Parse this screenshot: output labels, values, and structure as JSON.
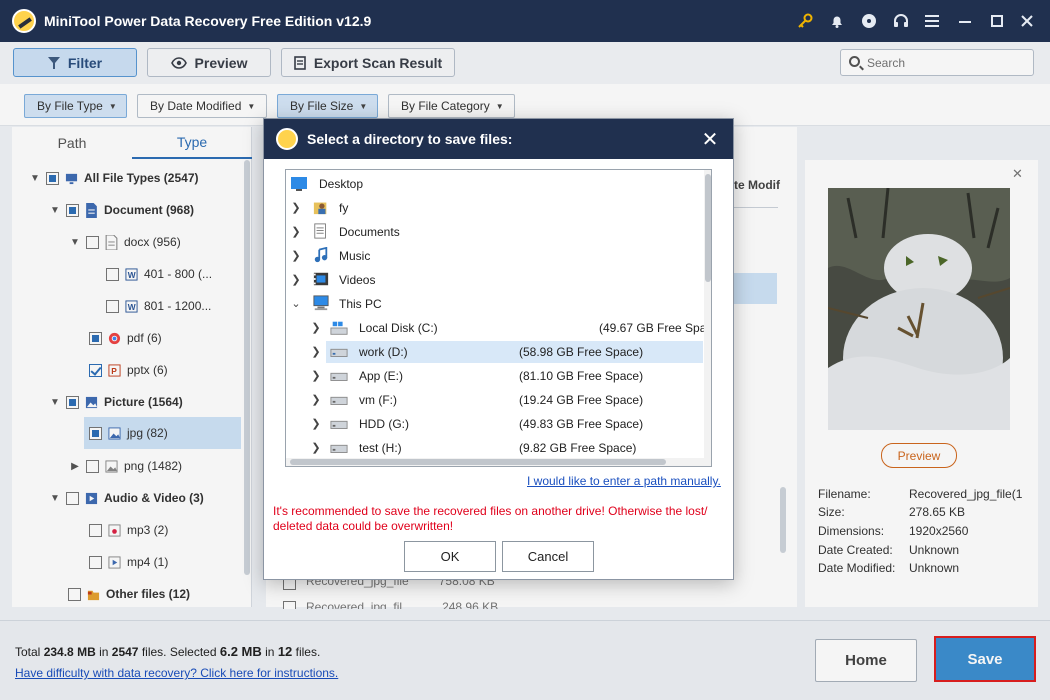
{
  "app": {
    "title": "MiniTool Power Data Recovery Free Edition v12.9"
  },
  "toolbar": {
    "filter_label": "Filter",
    "preview_label": "Preview",
    "export_label": "Export Scan Result",
    "search_placeholder": "Search"
  },
  "filters": {
    "file_type": "By File Type",
    "date_modified": "By Date Modified",
    "file_size": "By File Size",
    "file_category": "By File Category"
  },
  "left": {
    "tabs": [
      "Path",
      "Type"
    ],
    "tree": [
      {
        "label": "All File Types (2547)"
      },
      {
        "label": "Document (968)"
      },
      {
        "label": "docx (956)"
      },
      {
        "label": "401 - 800 (..."
      },
      {
        "label": "801 - 1200..."
      },
      {
        "label": "pdf (6)"
      },
      {
        "label": "pptx (6)"
      },
      {
        "label": "Picture (1564)"
      },
      {
        "label": "jpg (82)"
      },
      {
        "label": "png (1482)"
      },
      {
        "label": "Audio & Video (3)"
      },
      {
        "label": "mp3 (2)"
      },
      {
        "label": "mp4 (1)"
      },
      {
        "label": "Other files (12)"
      }
    ]
  },
  "middle": {
    "col_header": "te Modif",
    "rows": [
      {
        "name": "Recovered_jpg_file",
        "size": "758.08 KB"
      },
      {
        "name": "Recovered_jpg_fil...",
        "size": "248.96 KB"
      }
    ]
  },
  "preview": {
    "button_label": "Preview",
    "fields": [
      {
        "key": "Filename:",
        "value": "Recovered_jpg_file(1"
      },
      {
        "key": "Size:",
        "value": "278.65 KB"
      },
      {
        "key": "Dimensions:",
        "value": "1920x2560"
      },
      {
        "key": "Date Created:",
        "value": "Unknown"
      },
      {
        "key": "Date Modified:",
        "value": "Unknown"
      }
    ]
  },
  "dialog": {
    "title": "Select a directory to save files:",
    "tree": [
      {
        "label": "Desktop",
        "space": ""
      },
      {
        "label": "fy",
        "space": ""
      },
      {
        "label": "Documents",
        "space": ""
      },
      {
        "label": "Music",
        "space": ""
      },
      {
        "label": "Videos",
        "space": ""
      },
      {
        "label": "This PC",
        "space": ""
      },
      {
        "label": "Local Disk (C:)",
        "space": "(49.67 GB Free Spa"
      },
      {
        "label": "work (D:)",
        "space": "(58.98 GB Free Space)"
      },
      {
        "label": "App (E:)",
        "space": "(81.10 GB Free Space)"
      },
      {
        "label": "vm (F:)",
        "space": "(19.24 GB Free Space)"
      },
      {
        "label": "HDD (G:)",
        "space": "(49.83 GB Free Space)"
      },
      {
        "label": "test (H:)",
        "space": "(9.82 GB Free Space)"
      }
    ],
    "manual_link": "I would like to enter a path manually.",
    "warning": "It's recommended to save the recovered files on another drive! Otherwise the lost/ deleted data could be overwritten!",
    "ok_label": "OK",
    "cancel_label": "Cancel"
  },
  "bottom": {
    "total_prefix": "Total",
    "total_size": "234.8 MB",
    "in1": "in",
    "total_files": "2547",
    "files_selected": "files.  Selected",
    "sel_size": "6.2 MB",
    "in2": "in",
    "sel_files": "12",
    "files_end": "files.",
    "help_link": "Have difficulty with data recovery? Click here for instructions.",
    "home_label": "Home",
    "save_label": "Save"
  }
}
